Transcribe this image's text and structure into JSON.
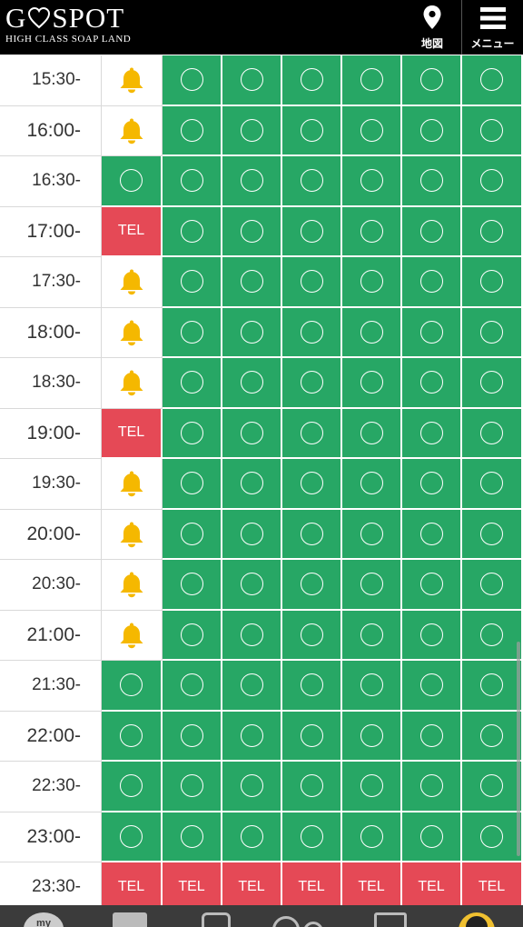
{
  "header": {
    "logo_main": "GSPOT",
    "logo_first": "G",
    "logo_rest": "SPOT",
    "logo_sub": "HIGH CLASS SOAP LAND",
    "map_label": "地図",
    "menu_label": "メニュー"
  },
  "colors": {
    "available": "#27a765",
    "tel": "#e54956",
    "bell": "#f5b800",
    "header_bg": "#000000"
  },
  "legend": {
    "available": "〇",
    "tel": "TEL",
    "bell": "bell-icon"
  },
  "schedule": {
    "rows": [
      {
        "time": "15:30-",
        "cells": [
          "bell",
          "avail",
          "avail",
          "avail",
          "avail",
          "avail",
          "avail"
        ]
      },
      {
        "time": "16:00-",
        "cells": [
          "bell",
          "avail",
          "avail",
          "avail",
          "avail",
          "avail",
          "avail"
        ]
      },
      {
        "time": "16:30-",
        "cells": [
          "avail",
          "avail",
          "avail",
          "avail",
          "avail",
          "avail",
          "avail"
        ]
      },
      {
        "time": "17:00-",
        "cells": [
          "tel",
          "avail",
          "avail",
          "avail",
          "avail",
          "avail",
          "avail"
        ]
      },
      {
        "time": "17:30-",
        "cells": [
          "bell",
          "avail",
          "avail",
          "avail",
          "avail",
          "avail",
          "avail"
        ]
      },
      {
        "time": "18:00-",
        "cells": [
          "bell",
          "avail",
          "avail",
          "avail",
          "avail",
          "avail",
          "avail"
        ]
      },
      {
        "time": "18:30-",
        "cells": [
          "bell",
          "avail",
          "avail",
          "avail",
          "avail",
          "avail",
          "avail"
        ]
      },
      {
        "time": "19:00-",
        "cells": [
          "tel",
          "avail",
          "avail",
          "avail",
          "avail",
          "avail",
          "avail"
        ]
      },
      {
        "time": "19:30-",
        "cells": [
          "bell",
          "avail",
          "avail",
          "avail",
          "avail",
          "avail",
          "avail"
        ]
      },
      {
        "time": "20:00-",
        "cells": [
          "bell",
          "avail",
          "avail",
          "avail",
          "avail",
          "avail",
          "avail"
        ]
      },
      {
        "time": "20:30-",
        "cells": [
          "bell",
          "avail",
          "avail",
          "avail",
          "avail",
          "avail",
          "avail"
        ]
      },
      {
        "time": "21:00-",
        "cells": [
          "bell",
          "avail",
          "avail",
          "avail",
          "avail",
          "avail",
          "avail"
        ]
      },
      {
        "time": "21:30-",
        "cells": [
          "avail",
          "avail",
          "avail",
          "avail",
          "avail",
          "avail",
          "avail"
        ]
      },
      {
        "time": "22:00-",
        "cells": [
          "avail",
          "avail",
          "avail",
          "avail",
          "avail",
          "avail",
          "avail"
        ]
      },
      {
        "time": "22:30-",
        "cells": [
          "avail",
          "avail",
          "avail",
          "avail",
          "avail",
          "avail",
          "avail"
        ]
      },
      {
        "time": "23:00-",
        "cells": [
          "avail",
          "avail",
          "avail",
          "avail",
          "avail",
          "avail",
          "avail"
        ]
      },
      {
        "time": "23:30-",
        "cells": [
          "tel",
          "tel",
          "tel",
          "tel",
          "tel",
          "tel",
          "tel"
        ]
      }
    ]
  },
  "bottom_nav": {
    "my_label": "my",
    "items": [
      "my-icon",
      "book-icon",
      "shop-icon",
      "chat-icon",
      "mail-icon",
      "user-icon"
    ]
  }
}
